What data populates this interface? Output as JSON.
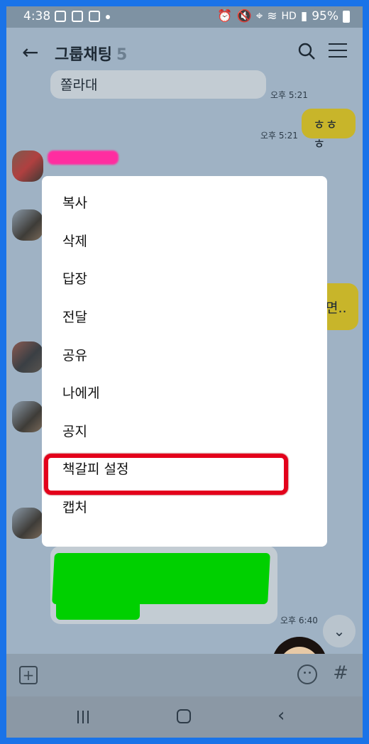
{
  "status_bar": {
    "time": "4:38",
    "hd_label": "HD",
    "battery": "95%"
  },
  "header": {
    "back_icon": "arrow-left",
    "title": "그룹채팅",
    "member_count": "5",
    "search_icon": "magnifier",
    "menu_icon": "hamburger"
  },
  "chat": {
    "messages": [
      {
        "text": "쫄라대",
        "time": "오후 5:21"
      },
      {
        "text": "ㅎㅎㅎ",
        "time": "오후 5:21"
      },
      {
        "text": "면..",
        "time": ""
      },
      {
        "text": "",
        "time": "오후 6:40"
      }
    ]
  },
  "context_menu": {
    "items": [
      "복사",
      "삭제",
      "답장",
      "전달",
      "공유",
      "나에게",
      "공지",
      "책갈피 설정",
      "캡처"
    ],
    "highlighted_index": 7
  },
  "input_bar": {
    "plus_icon": "plus-square",
    "emoji_icon": "smiley",
    "hash_label": "#"
  },
  "colors": {
    "frame_border": "#1a73e8",
    "chat_bg": "#9fb2c4",
    "highlight": "#e3001b"
  }
}
